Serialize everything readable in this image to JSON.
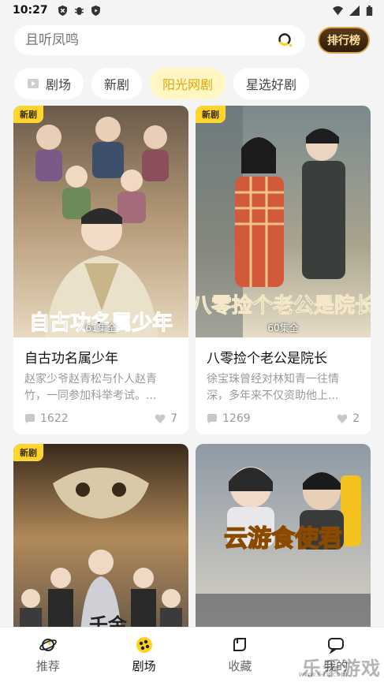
{
  "status": {
    "time": "10:27",
    "left_icons": [
      "shield-icon",
      "bug-icon",
      "play-shield-icon"
    ],
    "right_icons": [
      "wifi-icon",
      "signal-icon",
      "battery-icon"
    ]
  },
  "search": {
    "placeholder": "且听凤鸣",
    "icon": "search-icon"
  },
  "rank_button": {
    "label": "排行榜"
  },
  "tabs": [
    {
      "label": "剧场",
      "icon": "theater-icon",
      "active": false
    },
    {
      "label": "新剧",
      "active": false
    },
    {
      "label": "阳光网剧",
      "active": true
    },
    {
      "label": "星选好剧",
      "active": false
    }
  ],
  "cards": [
    {
      "badge": "新剧",
      "episodes": "61集全",
      "poster_text": "自古功名属少年",
      "title": "自古功名属少年",
      "desc": "赵家少爷赵青松与仆人赵青竹，一同参加科举考试。...",
      "views": "1622",
      "likes": "7"
    },
    {
      "badge": "新剧",
      "episodes": "60集全",
      "poster_text": "八零捡个老公是院长",
      "title": "八零捡个老公是院长",
      "desc": "徐宝珠曾经对林知青一往情深，多年来不仅资助他上...",
      "views": "1269",
      "likes": "2"
    },
    {
      "badge": "新剧",
      "poster_text": "千金"
    },
    {
      "badge": "",
      "poster_text": "云游食使君"
    }
  ],
  "bottom_nav": [
    {
      "label": "推荐",
      "icon": "planet-icon",
      "active": false
    },
    {
      "label": "剧场",
      "icon": "theater-icon",
      "active": true
    },
    {
      "label": "收藏",
      "icon": "bookmark-icon",
      "active": false
    },
    {
      "label": "我的",
      "icon": "chat-icon",
      "active": false
    }
  ],
  "watermark": {
    "text": "乐乐游戏",
    "url": "www.61ll.com"
  }
}
